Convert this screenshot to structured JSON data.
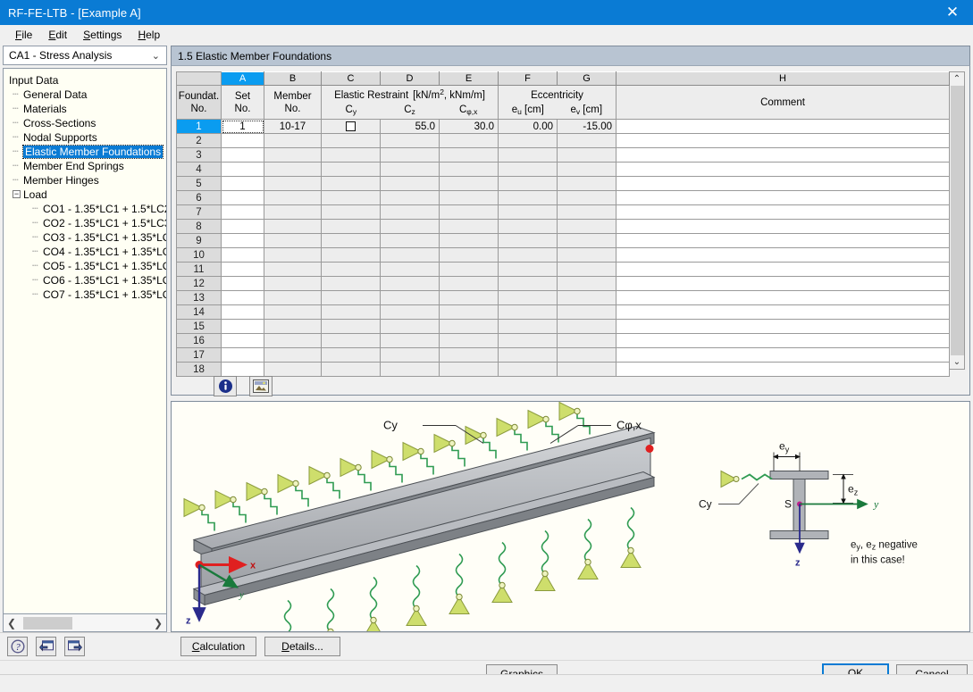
{
  "window": {
    "title": "RF-FE-LTB - [Example A]",
    "close_label": "✕"
  },
  "menu": {
    "items": [
      {
        "label": "File",
        "accel": "F"
      },
      {
        "label": "Edit",
        "accel": "E"
      },
      {
        "label": "Settings",
        "accel": "S"
      },
      {
        "label": "Help",
        "accel": "H"
      }
    ]
  },
  "sidebar": {
    "combo_value": "CA1 - Stress Analysis",
    "chevron": "⌄",
    "tree": [
      {
        "label": "Input Data",
        "level": 0,
        "selected": false,
        "expander": null
      },
      {
        "label": "General Data",
        "level": 1,
        "selected": false,
        "expander": null
      },
      {
        "label": "Materials",
        "level": 1,
        "selected": false,
        "expander": null
      },
      {
        "label": "Cross-Sections",
        "level": 1,
        "selected": false,
        "expander": null
      },
      {
        "label": "Nodal Supports",
        "level": 1,
        "selected": false,
        "expander": null
      },
      {
        "label": "Elastic Member Foundations",
        "level": 1,
        "selected": true,
        "expander": null
      },
      {
        "label": "Member End Springs",
        "level": 1,
        "selected": false,
        "expander": null
      },
      {
        "label": "Member Hinges",
        "level": 1,
        "selected": false,
        "expander": null
      },
      {
        "label": "Load",
        "level": 1,
        "selected": false,
        "expander": "−"
      },
      {
        "label": "CO1 - 1.35*LC1 + 1.5*LC2",
        "level": 2,
        "selected": false,
        "expander": null
      },
      {
        "label": "CO2 - 1.35*LC1 + 1.5*LC3",
        "level": 2,
        "selected": false,
        "expander": null
      },
      {
        "label": "CO3 - 1.35*LC1 + 1.35*LC",
        "level": 2,
        "selected": false,
        "expander": null
      },
      {
        "label": "CO4 - 1.35*LC1 + 1.35*LC",
        "level": 2,
        "selected": false,
        "expander": null
      },
      {
        "label": "CO5 - 1.35*LC1 + 1.35*LC",
        "level": 2,
        "selected": false,
        "expander": null
      },
      {
        "label": "CO6 - 1.35*LC1 + 1.35*LC",
        "level": 2,
        "selected": false,
        "expander": null
      },
      {
        "label": "CO7 - 1.35*LC1 + 1.35*LC",
        "level": 2,
        "selected": false,
        "expander": null
      }
    ],
    "hscroll": {
      "left_arrow": "❮",
      "right_arrow": "❯"
    }
  },
  "panel": {
    "title": "1.5 Elastic Member Foundations"
  },
  "table": {
    "column_letters": [
      "",
      "A",
      "B",
      "C",
      "D",
      "E",
      "F",
      "G",
      "H"
    ],
    "active_column": "A",
    "headers": {
      "row_no": [
        "Foundat.",
        "No."
      ],
      "a": [
        "Set",
        "No."
      ],
      "b": [
        "Member",
        "No."
      ],
      "group_restraint": "Elastic Restraint",
      "group_restraint_units": "[kN/m², kNm/m]",
      "c_sub": "Cy",
      "d_sub": "Cz",
      "e_sub": "Cφ,x",
      "group_eccentricity": "Eccentricity",
      "f_sub": "eu [cm]",
      "g_sub": "ev [cm]",
      "h": "Comment"
    },
    "row_numbers": [
      1,
      2,
      3,
      4,
      5,
      6,
      7,
      8,
      9,
      10,
      11,
      12,
      13,
      14,
      15,
      16,
      17,
      18
    ],
    "selected_row": 1,
    "rows": [
      {
        "no": 1,
        "set_no": "1",
        "member_no": "10-17",
        "cy": "checkbox-unchecked",
        "cz": "55.0",
        "cphix": "30.0",
        "eu": "0.00",
        "ev": "-15.00",
        "comment": ""
      }
    ],
    "vscroll": {
      "up": "⌃",
      "down": "⌄"
    }
  },
  "grid_toolbar": {
    "info_button": "info-icon",
    "picture_button": "picture-icon"
  },
  "graphic": {
    "label_cy_top": "Cy",
    "label_cphix": "Cφ,x",
    "axis_x": "x",
    "axis_y": "y",
    "axis_z": "z",
    "section_label_cy": "Cy",
    "section_ey": "ey",
    "section_ez": "ez",
    "section_centroid": "S",
    "section_axis_y": "y",
    "section_axis_z": "z",
    "note_line1": "ey, ez negative",
    "note_line2": "in this case!"
  },
  "bottom": {
    "help_button": "help-icon",
    "prev_button": "prev-pane-icon",
    "next_button": "next-pane-icon",
    "calculation": {
      "label": "Calculation",
      "accel": "C"
    },
    "details": {
      "label": "Details...",
      "accel": "D"
    },
    "graphics": {
      "label": "Graphics",
      "accel": "G"
    },
    "ok": "OK",
    "cancel": "Cancel"
  },
  "colors": {
    "title_bar": "#0a7bd4",
    "accent": "#0a9cf0",
    "panel_header": "#b8c4d2",
    "graphic_bg": "#fffef7",
    "spring_green": "#35a85b",
    "support_yellow": "#cbdb5a"
  }
}
